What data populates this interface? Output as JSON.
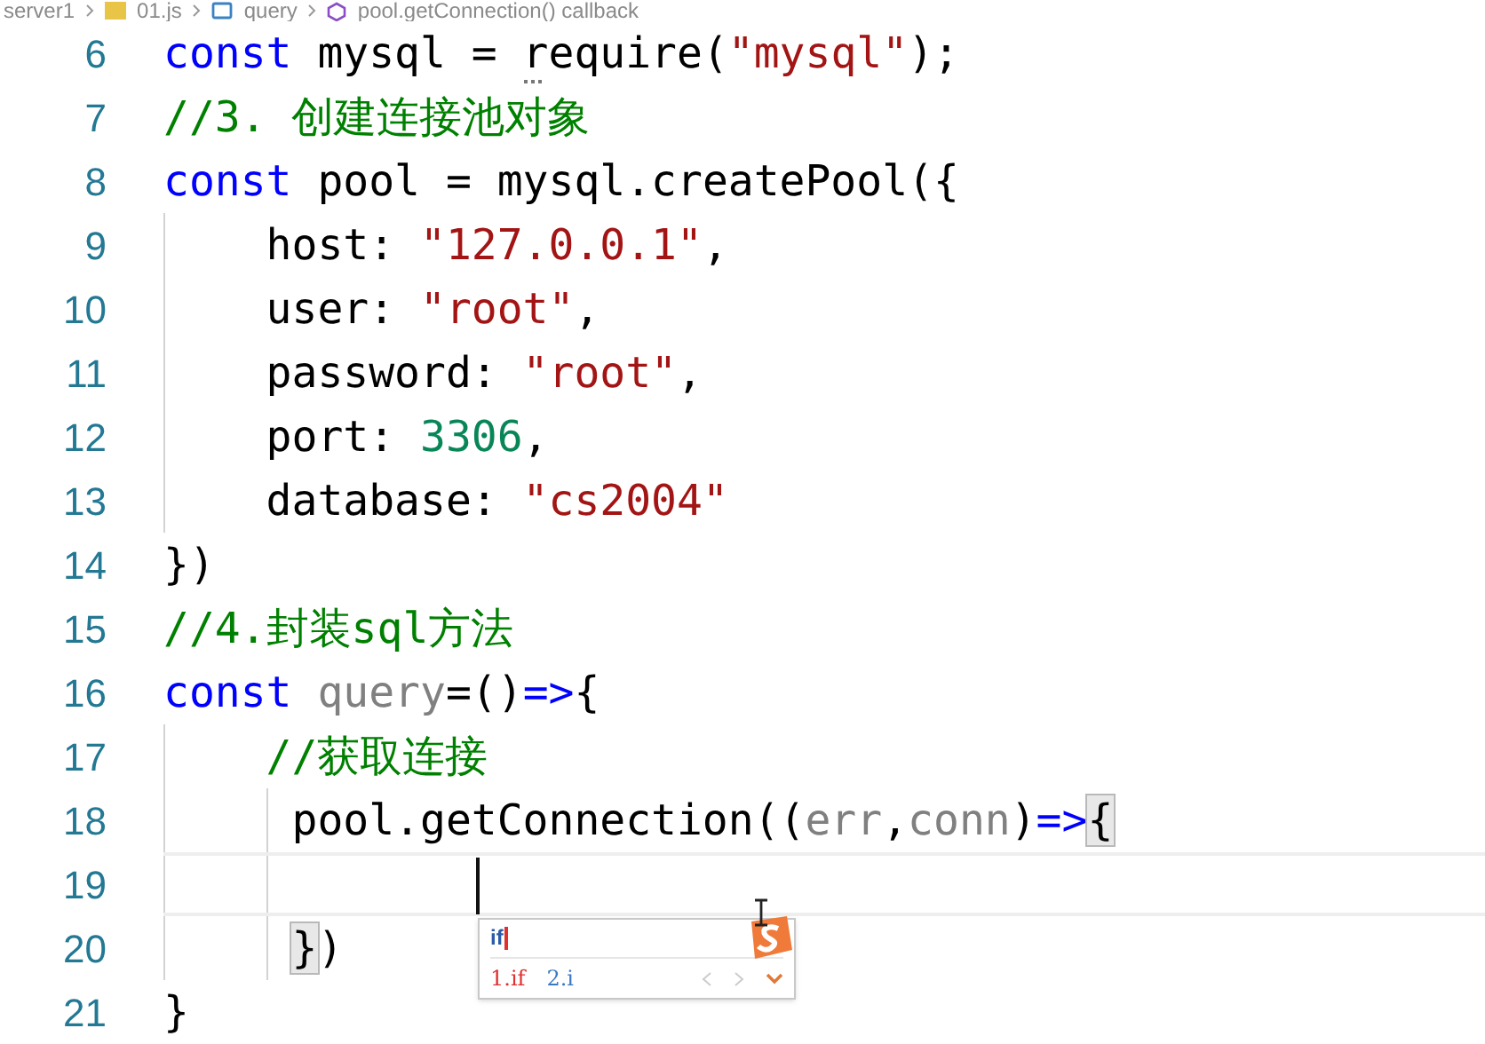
{
  "breadcrumb": [
    {
      "kind": "folder",
      "text": "server1"
    },
    {
      "kind": "js-file",
      "text": "01.js"
    },
    {
      "kind": "variable",
      "text": "query"
    },
    {
      "kind": "method",
      "text": "pool.getConnection() callback"
    }
  ],
  "lines": [
    {
      "number": "6",
      "current": false,
      "cursor": false,
      "tokens": [
        {
          "kind": "keyword",
          "text": "const"
        },
        {
          "kind": "plain",
          "text": " mysql = "
        },
        {
          "kind": "hinted",
          "text": "r"
        },
        {
          "kind": "plain",
          "text": "equire("
        },
        {
          "kind": "string",
          "text": "\"mysql\""
        },
        {
          "kind": "plain",
          "text": ");"
        }
      ]
    },
    {
      "number": "7",
      "current": false,
      "cursor": false,
      "tokens": [
        {
          "kind": "comment",
          "text": "//3. 创建连接池对象"
        }
      ]
    },
    {
      "number": "8",
      "current": false,
      "cursor": false,
      "tokens": [
        {
          "kind": "keyword",
          "text": "const"
        },
        {
          "kind": "plain",
          "text": " pool = mysql.createPool({"
        }
      ]
    },
    {
      "number": "9",
      "current": false,
      "cursor": false,
      "tokens": [
        {
          "kind": "plain",
          "text": "    host: "
        },
        {
          "kind": "string",
          "text": "\"127.0.0.1\""
        },
        {
          "kind": "plain",
          "text": ","
        }
      ]
    },
    {
      "number": "10",
      "current": false,
      "cursor": false,
      "tokens": [
        {
          "kind": "plain",
          "text": "    user: "
        },
        {
          "kind": "string",
          "text": "\"root\""
        },
        {
          "kind": "plain",
          "text": ","
        }
      ]
    },
    {
      "number": "11",
      "current": false,
      "cursor": false,
      "tokens": [
        {
          "kind": "plain",
          "text": "    password: "
        },
        {
          "kind": "string",
          "text": "\"root\""
        },
        {
          "kind": "plain",
          "text": ","
        }
      ]
    },
    {
      "number": "12",
      "current": false,
      "cursor": false,
      "tokens": [
        {
          "kind": "plain",
          "text": "    port: "
        },
        {
          "kind": "number",
          "text": "3306"
        },
        {
          "kind": "plain",
          "text": ","
        }
      ]
    },
    {
      "number": "13",
      "current": false,
      "cursor": false,
      "tokens": [
        {
          "kind": "plain",
          "text": "    database: "
        },
        {
          "kind": "string",
          "text": "\"cs2004\""
        }
      ]
    },
    {
      "number": "14",
      "current": false,
      "cursor": false,
      "tokens": [
        {
          "kind": "plain",
          "text": "})"
        }
      ]
    },
    {
      "number": "15",
      "current": false,
      "cursor": false,
      "tokens": [
        {
          "kind": "comment",
          "text": "//4.封装sql方法"
        }
      ]
    },
    {
      "number": "16",
      "current": false,
      "cursor": false,
      "tokens": [
        {
          "kind": "keyword",
          "text": "const"
        },
        {
          "kind": "unused",
          "text": " query"
        },
        {
          "kind": "plain",
          "text": "=()"
        },
        {
          "kind": "keyword",
          "text": "=>"
        },
        {
          "kind": "plain",
          "text": "{"
        }
      ]
    },
    {
      "number": "17",
      "current": false,
      "cursor": false,
      "tokens": [
        {
          "kind": "comment",
          "text": "    //获取连接"
        }
      ]
    },
    {
      "number": "18",
      "current": false,
      "cursor": false,
      "tokens": [
        {
          "kind": "plain",
          "text": "     pool.getConnection(("
        },
        {
          "kind": "unused",
          "text": "err"
        },
        {
          "kind": "plain",
          "text": ","
        },
        {
          "kind": "unused",
          "text": "conn"
        },
        {
          "kind": "plain",
          "text": ")"
        },
        {
          "kind": "keyword",
          "text": "=>"
        },
        {
          "kind": "bracket-match",
          "text": "{"
        }
      ]
    },
    {
      "number": "19",
      "current": true,
      "cursor": true
    },
    {
      "number": "20",
      "current": false,
      "cursor": false,
      "tokens": [
        {
          "kind": "bracket-match",
          "text": "     }"
        },
        {
          "kind": "plain",
          "text": ")"
        }
      ]
    },
    {
      "number": "21",
      "current": false,
      "cursor": false,
      "tokens": [
        {
          "kind": "plain",
          "text": "}"
        }
      ]
    }
  ],
  "ime": {
    "input": "if",
    "candidates": [
      {
        "text": "1.if",
        "selected": true
      },
      {
        "text": "2.i",
        "selected": false
      }
    ]
  }
}
